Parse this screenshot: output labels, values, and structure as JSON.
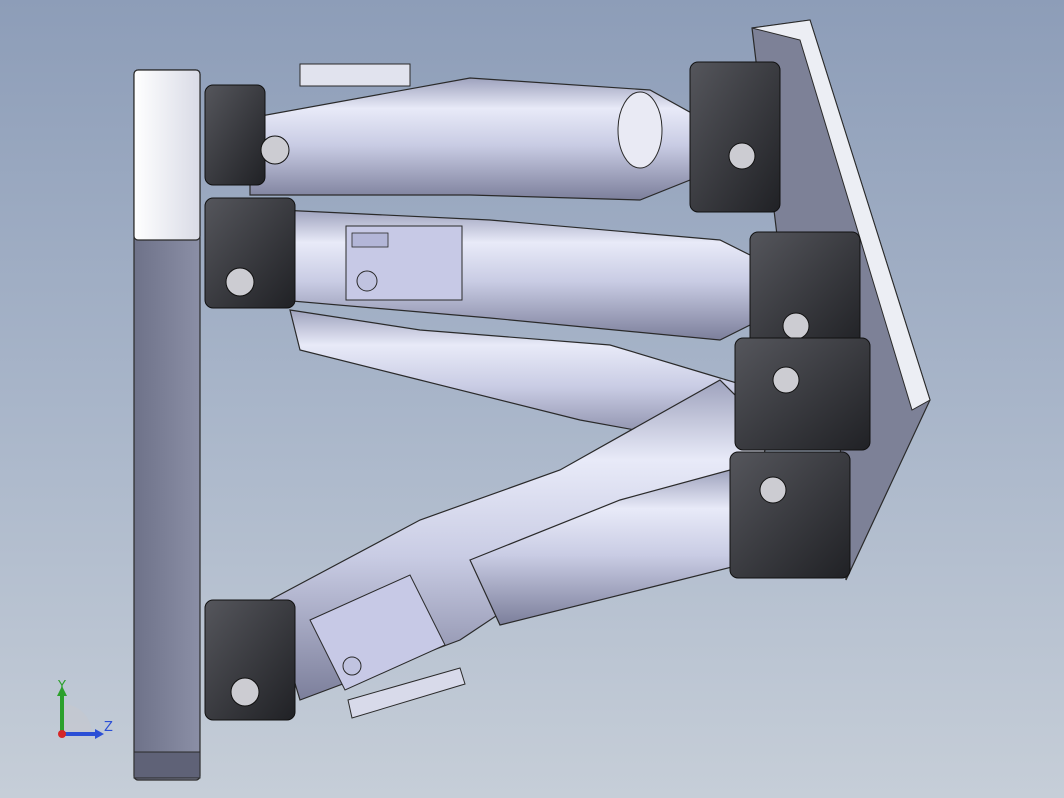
{
  "view": {
    "colors": {
      "bg_top": "#8d9db8",
      "bg_bottom": "#c6ced8",
      "plate": "#7d8197",
      "plate_face": "#f1f2f6",
      "cylinder": "#d6d9ee",
      "joint": "#3a3b40"
    }
  },
  "triad": {
    "y_label": "Y",
    "z_label": "Z",
    "y_color": "#2ca02c",
    "z_color": "#2b4fd6",
    "x_color": "#d62728"
  }
}
